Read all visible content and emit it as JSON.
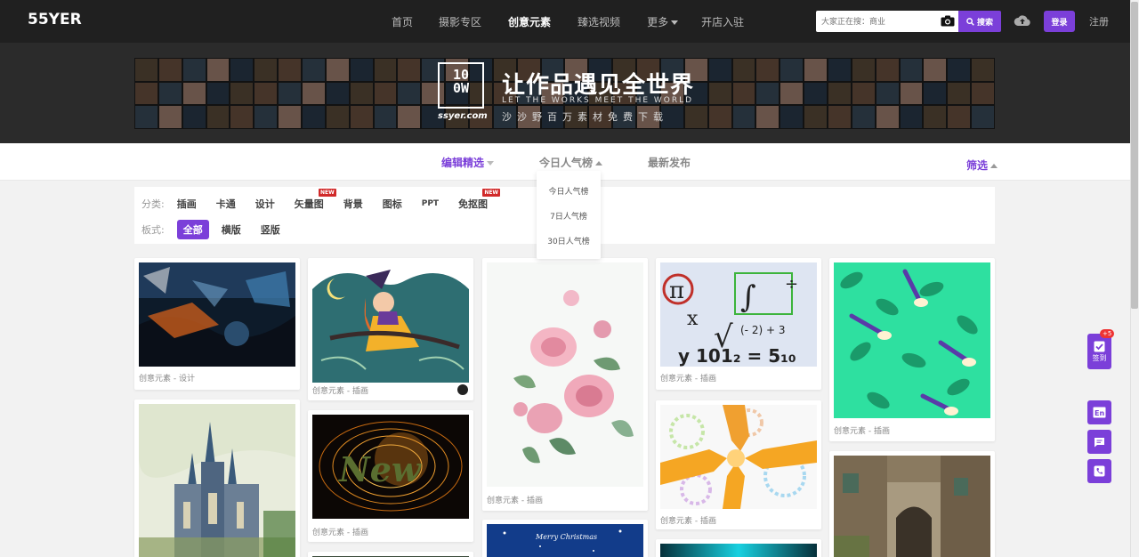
{
  "header": {
    "logo": "55YER",
    "nav": [
      {
        "label": "首页",
        "active": false
      },
      {
        "label": "摄影专区",
        "active": false
      },
      {
        "label": "创意元素",
        "active": true
      },
      {
        "label": "臻选视频",
        "active": false
      },
      {
        "label": "更多",
        "active": false
      },
      {
        "label": "开店入驻",
        "active": false
      }
    ],
    "search_placeholder": "大家正在搜：商业",
    "search_button": "搜索",
    "login": "登录",
    "register": "注册"
  },
  "banner": {
    "logo_text": "100W",
    "site": "ssyer.com",
    "title": "让作品遇见全世界",
    "subtitle": "LET THE WORKS MEET THE WORLD",
    "tagline": "沙沙野百万素材免费下载"
  },
  "sort": {
    "tabs": [
      {
        "label": "编辑精选",
        "active": true
      },
      {
        "label": "今日人气榜",
        "active": false
      },
      {
        "label": "最新发布",
        "active": false
      }
    ],
    "filter": "筛选",
    "dropdown": [
      "今日人气榜",
      "7日人气榜",
      "30日人气榜"
    ]
  },
  "categories": {
    "label": "分类:",
    "items": [
      {
        "label": "插画",
        "new": ""
      },
      {
        "label": "卡通",
        "new": ""
      },
      {
        "label": "设计",
        "new": ""
      },
      {
        "label": "矢量图",
        "new": "NEW"
      },
      {
        "label": "背景",
        "new": ""
      },
      {
        "label": "图标",
        "new": ""
      },
      {
        "label": "PPT",
        "new": ""
      },
      {
        "label": "免抠图",
        "new": "NEW"
      }
    ],
    "format_label": "板式:",
    "formats": [
      {
        "label": "全部",
        "active": true
      },
      {
        "label": "横版",
        "active": false
      },
      {
        "label": "竖版",
        "active": false
      }
    ]
  },
  "cards": [
    {
      "caption": "创意元素 - 设计",
      "image": "abstract-dark-painting"
    },
    {
      "caption": "创意元素 - 插画",
      "image": "witch-on-broom-illustration"
    },
    {
      "caption": "创意元素 - 插画",
      "image": "watercolor-roses"
    },
    {
      "caption": "创意元素 - 插画",
      "image": "math-formulas-collage"
    },
    {
      "caption": "创意元素 - 插画",
      "image": "green-leaves-pattern"
    },
    {
      "caption": "",
      "image": "gothic-cathedral-painting"
    },
    {
      "caption": "创意元素 - 插画",
      "image": "new-text-swirl"
    },
    {
      "caption": "创意元素 - 插画",
      "image": "hands-gears-colorful"
    },
    {
      "caption": "",
      "image": "merry-christmas-blue"
    },
    {
      "caption": "",
      "image": "stone-village-alley"
    },
    {
      "caption": "",
      "image": "cyan-glow"
    }
  ],
  "christmas_text": "Merry Christmas",
  "new_text": "New",
  "sidebar": {
    "checkin": "签到",
    "badge": "+5",
    "lang": "En"
  },
  "colors": {
    "accent": "#7b3fd9",
    "nav_bg": "#202020"
  }
}
